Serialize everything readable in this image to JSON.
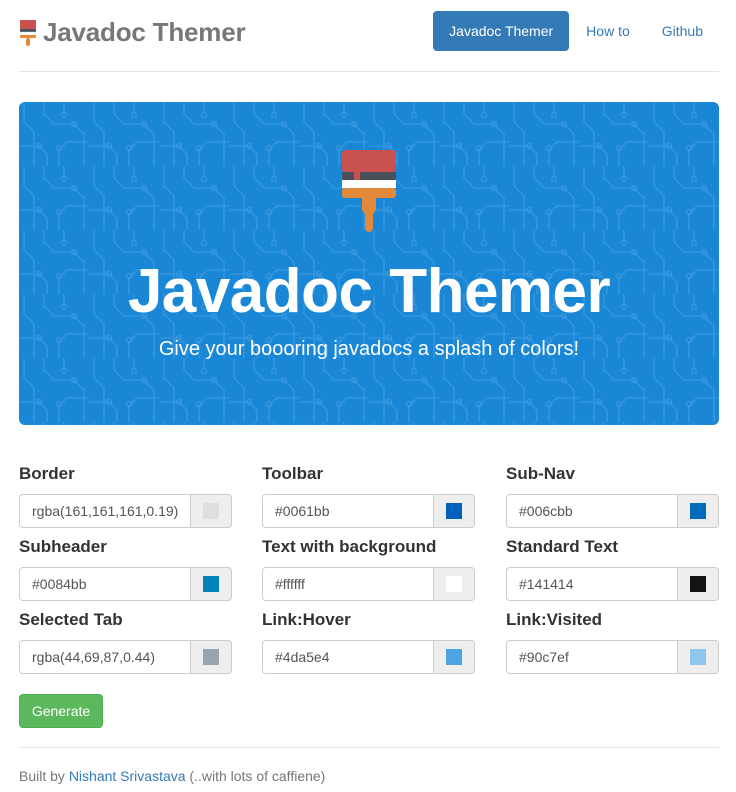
{
  "header": {
    "brand_title": "Javadoc Themer",
    "brand_icon": "paintbrush-icon",
    "nav": [
      {
        "label": "Javadoc Themer",
        "active": true
      },
      {
        "label": "How to",
        "active": false
      },
      {
        "label": "Github",
        "active": false
      }
    ]
  },
  "hero": {
    "icon": "paintbrush-icon",
    "title": "Javadoc Themer",
    "subtitle": "Give your boooring javadocs a splash of colors!",
    "background_color": "#1a87d6"
  },
  "fields": [
    {
      "label": "Border",
      "value": "rgba(161,161,161,0.19)",
      "swatch": "rgba(161,161,161,0.19)"
    },
    {
      "label": "Toolbar",
      "value": "#0061bb",
      "swatch": "#0061bb"
    },
    {
      "label": "Sub-Nav",
      "value": "#006cbb",
      "swatch": "#006cbb"
    },
    {
      "label": "Subheader",
      "value": "#0084bb",
      "swatch": "#0084bb"
    },
    {
      "label": "Text with background",
      "value": "#ffffff",
      "swatch": "#ffffff"
    },
    {
      "label": "Standard Text",
      "value": "#141414",
      "swatch": "#141414"
    },
    {
      "label": "Selected Tab",
      "value": "rgba(44,69,87,0.44)",
      "swatch": "rgba(44,69,87,0.44)"
    },
    {
      "label": "Link:Hover",
      "value": "#4da5e4",
      "swatch": "#4da5e4"
    },
    {
      "label": "Link:Visited",
      "value": "#90c7ef",
      "swatch": "#90c7ef"
    }
  ],
  "generate_button": {
    "label": "Generate",
    "color": "#5cb85c"
  },
  "footer": {
    "prefix": "Built by",
    "author": "Nishant Srivastava",
    "suffix": "(..with lots of caffiene)"
  }
}
